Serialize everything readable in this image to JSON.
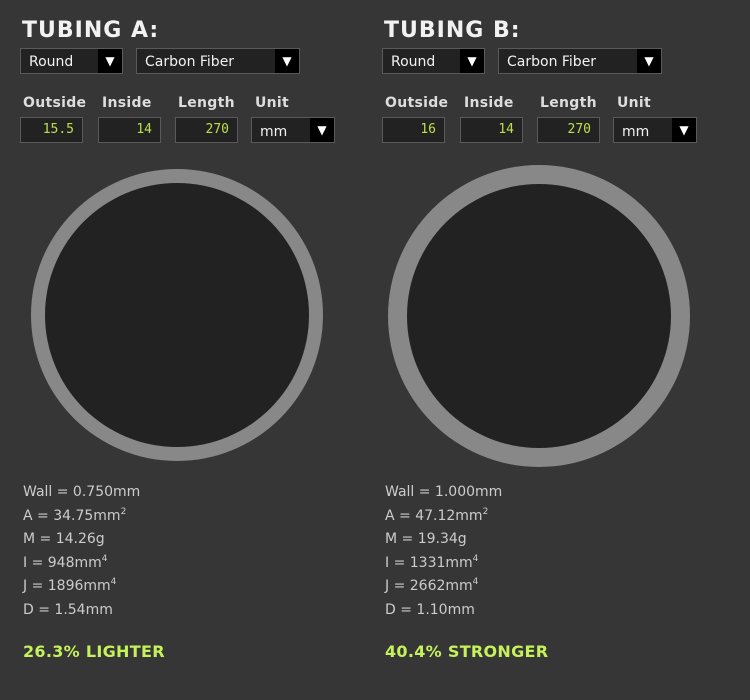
{
  "colors": {
    "background": "#363636",
    "accent": "#c5f25a",
    "input_text": "#b8e04a",
    "ring": "#888888",
    "bore": "#222222"
  },
  "tubing_a": {
    "title": "TUBING A:",
    "shape": {
      "value": "Round",
      "icon": "chevron-down-icon"
    },
    "material": {
      "value": "Carbon Fiber",
      "icon": "chevron-down-icon"
    },
    "labels": {
      "outside": "Outside",
      "inside": "Inside",
      "length": "Length",
      "unit": "Unit"
    },
    "outside": "15.5",
    "inside": "14",
    "length": "270",
    "unit": "mm",
    "stats": {
      "wall": "Wall = 0.750mm",
      "area": "A = 34.75mm",
      "area_sup": "2",
      "mass": "M = 14.26g",
      "i": "I = 948mm",
      "i_sup": "4",
      "j": "J = 1896mm",
      "j_sup": "4",
      "d": "D = 1.54mm"
    },
    "result": "26.3% LIGHTER"
  },
  "tubing_b": {
    "title": "TUBING B:",
    "shape": {
      "value": "Round",
      "icon": "chevron-down-icon"
    },
    "material": {
      "value": "Carbon Fiber",
      "icon": "chevron-down-icon"
    },
    "labels": {
      "outside": "Outside",
      "inside": "Inside",
      "length": "Length",
      "unit": "Unit"
    },
    "outside": "16",
    "inside": "14",
    "length": "270",
    "unit": "mm",
    "stats": {
      "wall": "Wall = 1.000mm",
      "area": "A = 47.12mm",
      "area_sup": "2",
      "mass": "M = 19.34g",
      "i": "I = 1331mm",
      "i_sup": "4",
      "j": "J = 2662mm",
      "j_sup": "4",
      "d": "D = 1.10mm"
    },
    "result": "40.4% STRONGER"
  }
}
